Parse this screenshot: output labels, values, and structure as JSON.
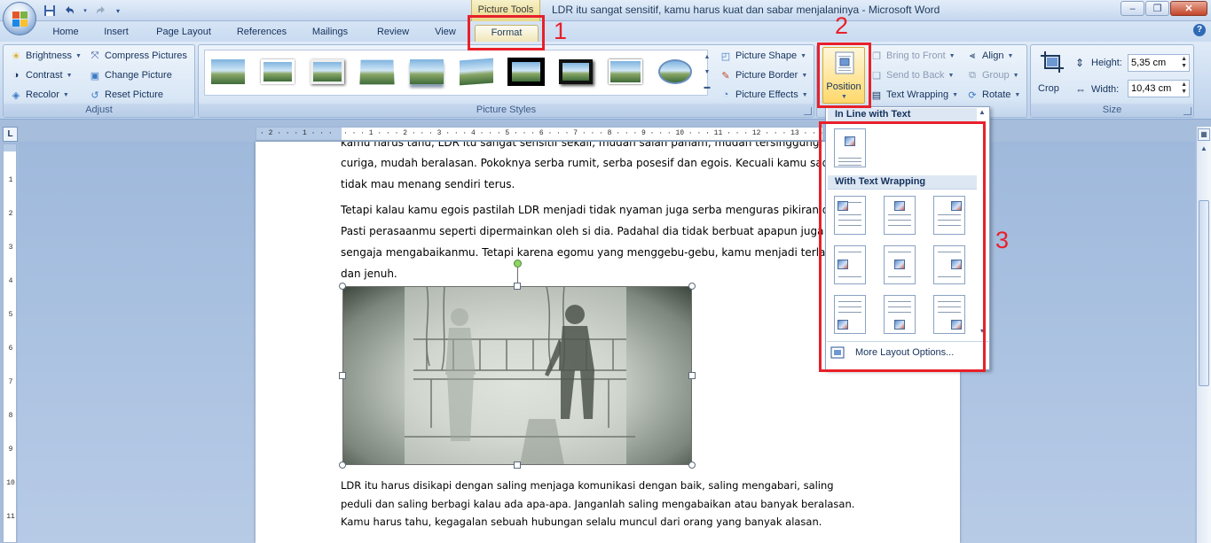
{
  "titlebar": {
    "context_tab": "Picture Tools",
    "document_title": "LDR itu sangat sensitif, kamu harus kuat dan sabar menjalaninya - Microsoft Word",
    "window_buttons": {
      "minimize": "–",
      "restore": "❐",
      "close": "✕"
    }
  },
  "quick_access": [
    {
      "name": "save-icon",
      "glyph": "💾"
    },
    {
      "name": "undo-icon",
      "glyph": "↶"
    },
    {
      "name": "redo-icon",
      "glyph": "↷"
    },
    {
      "name": "customize-icon",
      "glyph": "▾"
    }
  ],
  "tabs": [
    "Home",
    "Insert",
    "Page Layout",
    "References",
    "Mailings",
    "Review",
    "View",
    "Format"
  ],
  "ribbon": {
    "adjust": {
      "label": "Adjust",
      "items": [
        "Brightness",
        "Contrast",
        "Recolor",
        "Compress Pictures",
        "Change Picture",
        "Reset Picture"
      ]
    },
    "picture_styles": {
      "label": "Picture Styles",
      "commands": [
        "Picture Shape",
        "Picture Border",
        "Picture Effects"
      ]
    },
    "arrange": {
      "position": "Position",
      "items": [
        "Bring to Front",
        "Send to Back",
        "Text Wrapping",
        "Align",
        "Group",
        "Rotate"
      ]
    },
    "size": {
      "label": "Size",
      "crop": "Crop",
      "height_label": "Height:",
      "height_value": "5,35 cm",
      "width_label": "Width:",
      "width_value": "10,43 cm"
    }
  },
  "document": {
    "paragraph1": [
      "kamu harus tahu, LDR itu sangat sensitif sekali, mudah salah paham, mudah tersinggung,",
      "curiga, mudah beralasan. Pokoknya serba rumit, serba posesif dan egois. Kecuali kamu sad",
      "tidak mau menang sendiri terus."
    ],
    "paragraph2": [
      "Tetapi kalau kamu egois pastilah LDR menjadi tidak nyaman juga serba menguras pikiran d",
      "Pasti perasaanmu seperti dipermainkan oleh si dia. Padahal dia tidak berbuat apapun juga",
      "sengaja mengabaikanmu. Tetapi karena egomu yang menggebu-gebu, kamu menjadi terla",
      "dan jenuh."
    ],
    "paragraph3": [
      "LDR itu  harus disikapi dengan saling menjaga komunikasi dengan baik, saling mengabari, saling",
      "peduli dan saling  berbagi kalau ada apa-apa. Janganlah saling mengabaikan atau banyak beralasan.",
      "Kamu harus tahu, kegagalan sebuah hubungan selalu muncul dari orang yang banyak alasan."
    ]
  },
  "position_menu": {
    "inline_header": "In Line with Text",
    "wrapping_header": "With Text Wrapping",
    "more_options": "More Layout Options...",
    "more_options_accel": "L"
  },
  "annotations": {
    "one": "1",
    "two": "2",
    "three": "3"
  },
  "colors": {
    "annotation_red": "#e8202a",
    "ribbon_blue": "#dfeaf7",
    "context_gold": "#e9d988"
  }
}
